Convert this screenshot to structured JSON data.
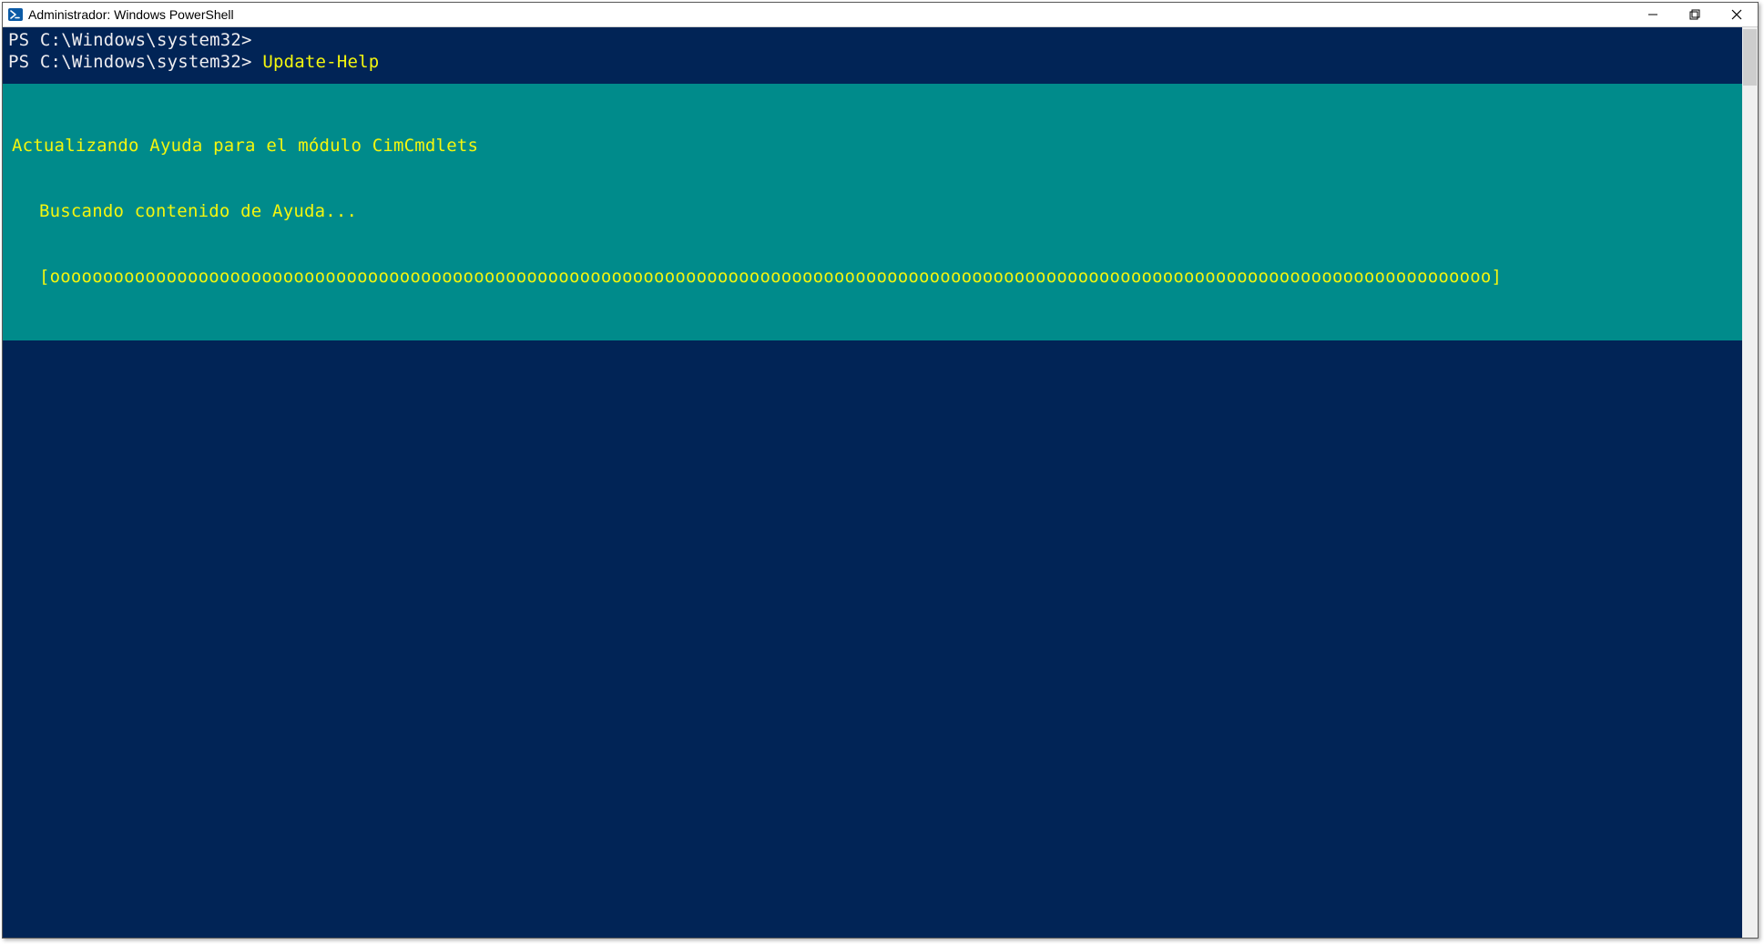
{
  "window": {
    "title": "Administrador: Windows PowerShell"
  },
  "terminal": {
    "prompt1": "PS C:\\Windows\\system32>",
    "prompt2": "PS C:\\Windows\\system32> ",
    "command": "Update-Help",
    "progress": {
      "header": "Actualizando Ayuda para el módulo CimCmdlets",
      "status": "Buscando contenido de Ayuda...",
      "bar": "[oooooooooooooooooooooooooooooooooooooooooooooooooooooooooooooooooooooooooooooooooooooooooooooooooooooooooooooooooooooooooooooooooooooooo]"
    }
  }
}
